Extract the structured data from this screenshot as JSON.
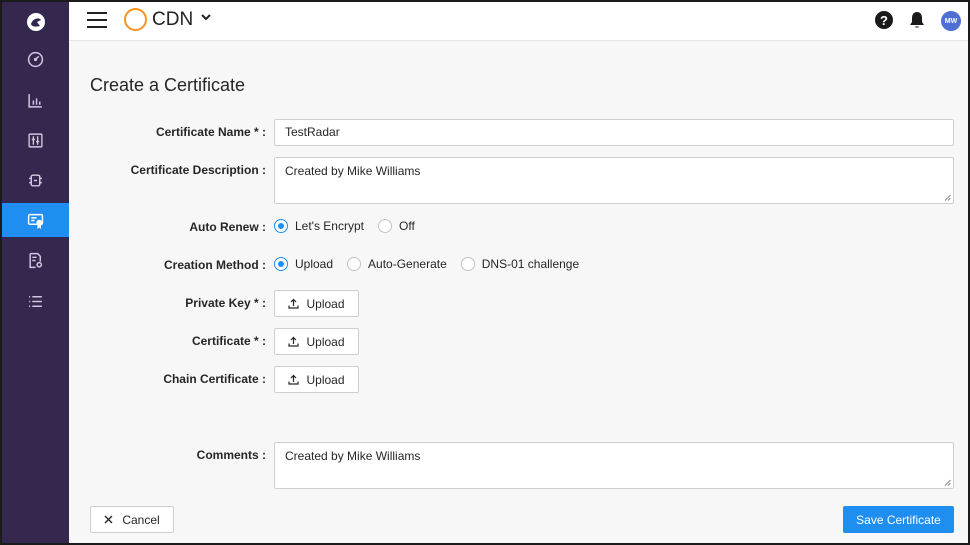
{
  "header": {
    "brand": "CDN",
    "help_glyph": "?",
    "avatar_initials": "MW"
  },
  "sidebar": {
    "items": [
      {
        "icon": "logo-icon"
      },
      {
        "icon": "dashboard-icon"
      },
      {
        "icon": "bar-chart-icon"
      },
      {
        "icon": "sliders-icon"
      },
      {
        "icon": "shield-icon"
      },
      {
        "icon": "certificate-icon",
        "active": true
      },
      {
        "icon": "document-settings-icon"
      },
      {
        "icon": "list-icon"
      }
    ]
  },
  "page": {
    "title": "Create a Certificate"
  },
  "form": {
    "cert_name": {
      "label": "Certificate Name * :",
      "value": "TestRadar"
    },
    "cert_description": {
      "label": "Certificate Description :",
      "value": "Created by Mike Williams"
    },
    "auto_renew": {
      "label": "Auto Renew :",
      "options": [
        "Let's Encrypt",
        "Off"
      ],
      "selected": "Let's Encrypt"
    },
    "creation_method": {
      "label": "Creation Method :",
      "options": [
        "Upload",
        "Auto-Generate",
        "DNS-01 challenge"
      ],
      "selected": "Upload"
    },
    "private_key": {
      "label": "Private Key * :",
      "button": "Upload"
    },
    "certificate": {
      "label": "Certificate * :",
      "button": "Upload"
    },
    "chain_certificate": {
      "label": "Chain Certificate :",
      "button": "Upload"
    },
    "comments": {
      "label": "Comments :",
      "value": "Created by Mike Williams"
    }
  },
  "footer": {
    "cancel_label": "Cancel",
    "save_label": "Save Certificate"
  },
  "colors": {
    "sidebar_bg": "#36274f",
    "accent": "#1f8ef1",
    "brand_ring": "#f7941d"
  }
}
